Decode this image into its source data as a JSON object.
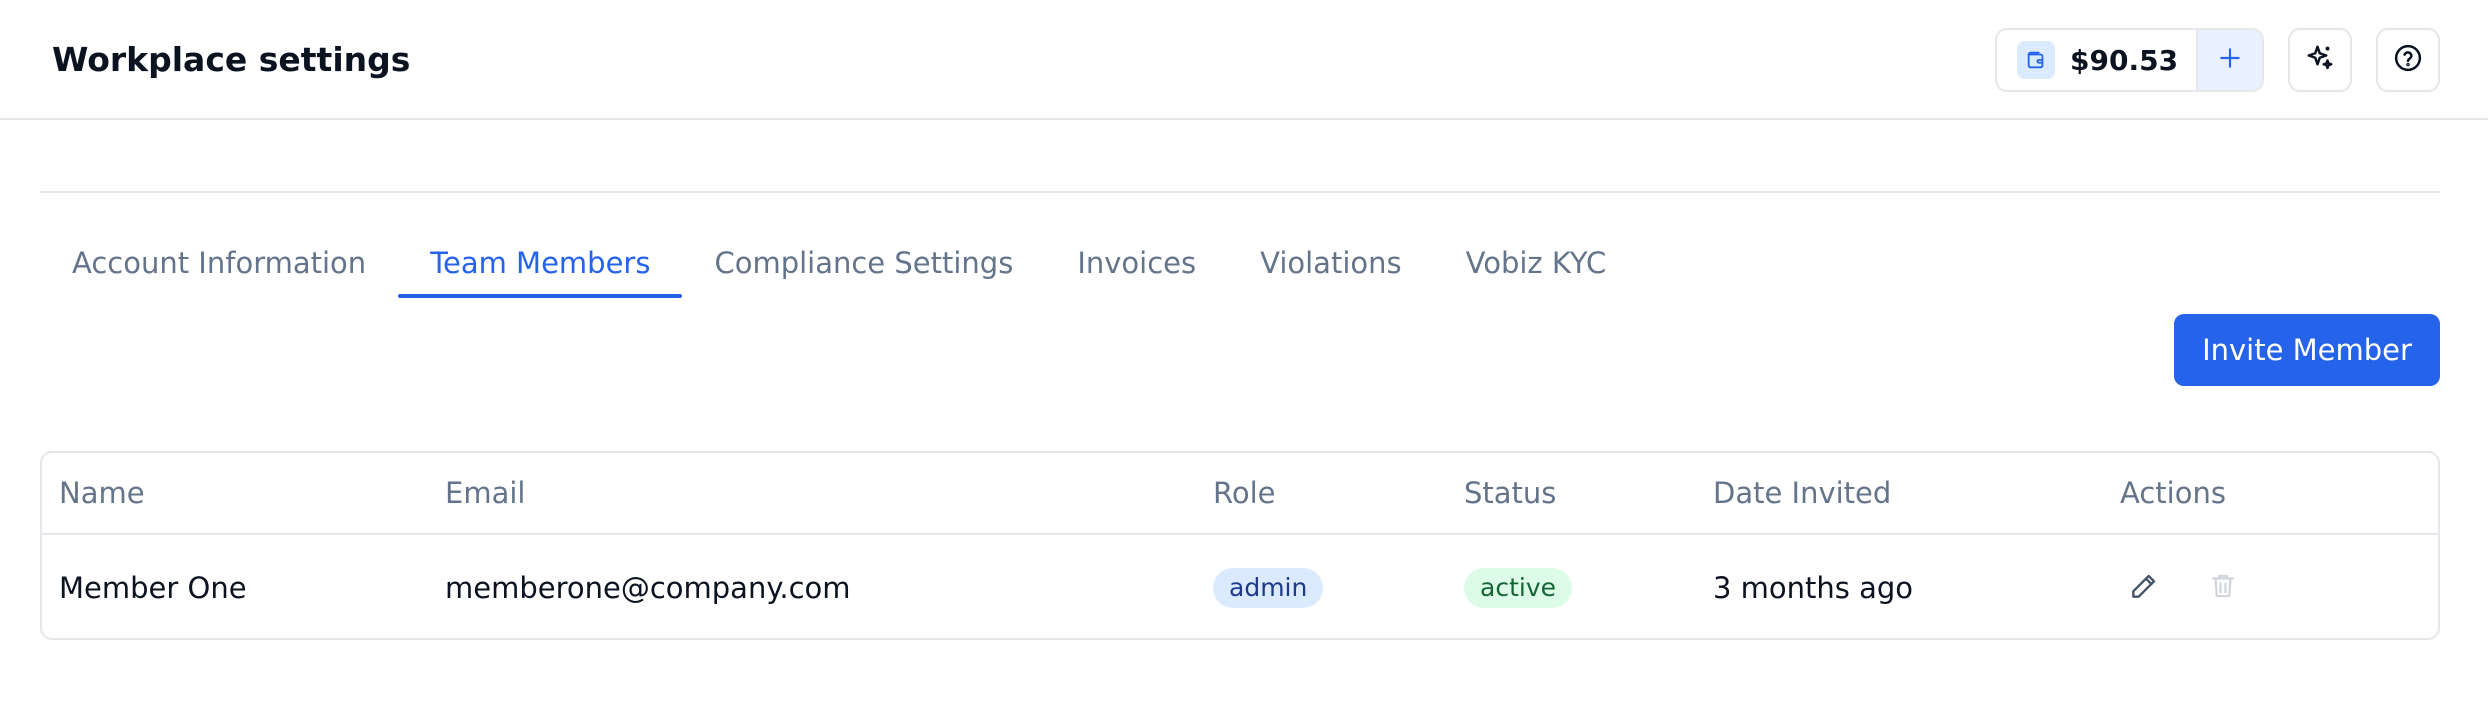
{
  "header": {
    "title": "Workplace settings",
    "wallet": {
      "amount": "$90.53",
      "icon": "wallet-icon",
      "add_icon": "plus-icon"
    },
    "ai_button_icon": "sparkles-icon",
    "help_button_icon": "help-circle-icon"
  },
  "tabs": [
    {
      "label": "Account Information",
      "active": false
    },
    {
      "label": "Team Members",
      "active": true
    },
    {
      "label": "Compliance Settings",
      "active": false
    },
    {
      "label": "Invoices",
      "active": false
    },
    {
      "label": "Violations",
      "active": false
    },
    {
      "label": "Vobiz KYC",
      "active": false
    }
  ],
  "invite_button": {
    "label": "Invite Member"
  },
  "table": {
    "columns": [
      "Name",
      "Email",
      "Role",
      "Status",
      "Date Invited",
      "Actions"
    ],
    "rows": [
      {
        "name": "Member One",
        "email": "memberone@company.com",
        "role": "admin",
        "status": "active",
        "date_invited": "3 months ago",
        "actions": [
          {
            "icon": "pencil-icon",
            "enabled": true
          },
          {
            "icon": "trash-icon",
            "enabled": false
          }
        ]
      }
    ]
  },
  "colors": {
    "accent": "#2563eb",
    "role_badge_bg": "#dbeafe",
    "status_badge_bg": "#dcfce7",
    "muted_text": "#64748b",
    "border": "#e5e7eb"
  }
}
